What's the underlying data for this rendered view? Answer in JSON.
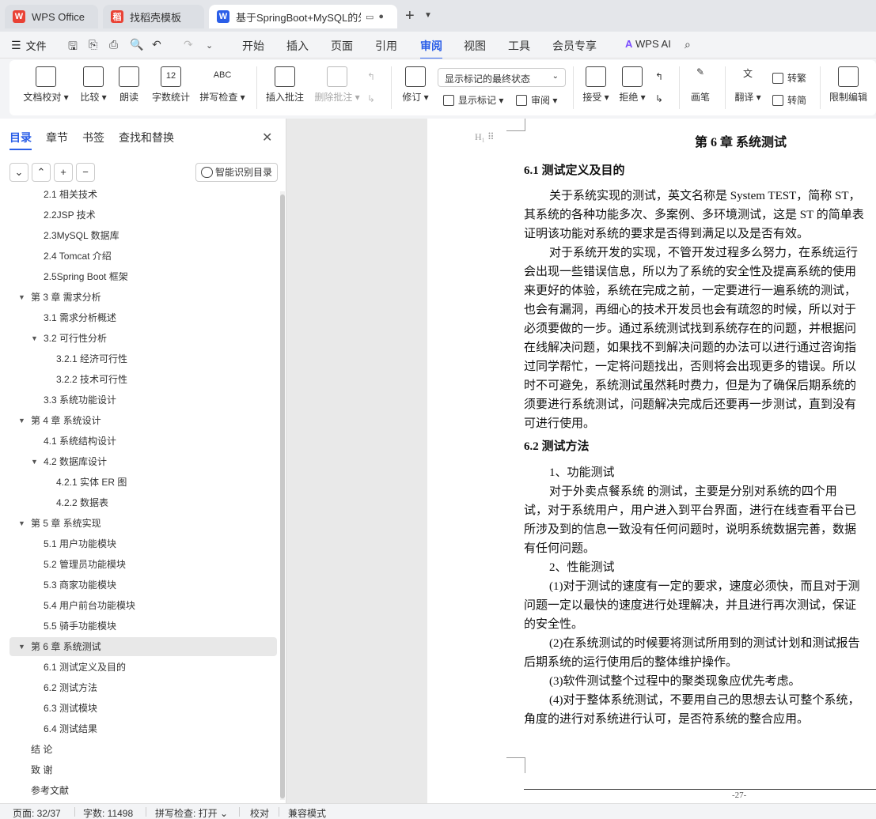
{
  "tabs": [
    {
      "label": "WPS Office",
      "icon": "wps-logo-icon"
    },
    {
      "label": "找稻壳模板",
      "icon": "docer-icon"
    },
    {
      "label": "基于SpringBoot+MySQL的外",
      "icon": "word-doc-icon"
    }
  ],
  "menu": {
    "file": "文件",
    "items": [
      "开始",
      "插入",
      "页面",
      "引用",
      "审阅",
      "视图",
      "工具",
      "会员专享"
    ],
    "active": "审阅",
    "wps_ai": "WPS AI"
  },
  "ribbon": {
    "doc_proof": "文档校对",
    "compare": "比较",
    "read_aloud": "朗读",
    "word_count": "字数统计",
    "spell_check": "拼写检查",
    "insert_comment": "插入批注",
    "delete_comment": "删除批注",
    "revise": "修订",
    "display_state": "显示标记的最终状态",
    "show_markup": "显示标记",
    "review": "审阅",
    "accept": "接受",
    "reject": "拒绝",
    "pen": "画笔",
    "translate": "翻译",
    "to_traditional": "转繁",
    "to_simplified": "转简",
    "restrict_edit": "限制编辑",
    "abc_label": "ABC",
    "count_label": "12"
  },
  "nav": {
    "tabs": [
      "目录",
      "章节",
      "书签",
      "查找和替换"
    ],
    "smart_toc": "智能识别目录",
    "toc": [
      {
        "label": "2.1 相关技术",
        "level": 2
      },
      {
        "label": "2.2JSP 技术",
        "level": 2
      },
      {
        "label": "2.3MySQL 数据库",
        "level": 2
      },
      {
        "label": "2.4 Tomcat 介绍",
        "level": 2
      },
      {
        "label": "2.5Spring Boot 框架",
        "level": 2
      },
      {
        "label": "第 3 章  需求分析",
        "level": 1,
        "expanded": true
      },
      {
        "label": "3.1 需求分析概述",
        "level": 2
      },
      {
        "label": "3.2 可行性分析",
        "level": 2,
        "expanded": true
      },
      {
        "label": "3.2.1 经济可行性",
        "level": 3
      },
      {
        "label": "3.2.2 技术可行性",
        "level": 3
      },
      {
        "label": "3.3 系统功能设计",
        "level": 2
      },
      {
        "label": "第 4 章  系统设计",
        "level": 1,
        "expanded": true
      },
      {
        "label": "4.1 系统结构设计",
        "level": 2
      },
      {
        "label": "4.2 数据库设计",
        "level": 2,
        "expanded": true
      },
      {
        "label": "4.2.1 实体 ER 图",
        "level": 3
      },
      {
        "label": "4.2.2 数据表",
        "level": 3
      },
      {
        "label": "第 5 章  系统实现",
        "level": 1,
        "expanded": true
      },
      {
        "label": "5.1 用户功能模块",
        "level": 2
      },
      {
        "label": "5.2 管理员功能模块",
        "level": 2
      },
      {
        "label": "5.3 商家功能模块",
        "level": 2
      },
      {
        "label": "5.4 用户前台功能模块",
        "level": 2
      },
      {
        "label": "5.5 骑手功能模块",
        "level": 2
      },
      {
        "label": "第 6 章  系统测试",
        "level": 1,
        "expanded": true,
        "selected": true
      },
      {
        "label": "6.1 测试定义及目的",
        "level": 2
      },
      {
        "label": "6.2 测试方法",
        "level": 2
      },
      {
        "label": "6.3 测试模块",
        "level": 2
      },
      {
        "label": "6.4 测试结果",
        "level": 2
      },
      {
        "label": "结    论",
        "level": 1
      },
      {
        "label": "致    谢",
        "level": 1
      },
      {
        "label": "参考文献",
        "level": 1
      }
    ]
  },
  "document": {
    "chapter_title": "第 6 章  系统测试",
    "heading_mark": "H",
    "sec1": "6.1 测试定义及目的",
    "p1": [
      "关于系统实现的测试，英文名称是 System TEST，简称 ST，",
      "其系统的各种功能多次、多案例、多环境测试，这是 ST 的简单表",
      "证明该功能对系统的要求是否得到满足以及是否有效。"
    ],
    "p2": [
      "对于系统开发的实现，不管开发过程多么努力，在系统运行",
      "会出现一些错误信息，所以为了系统的安全性及提高系统的使用",
      "来更好的体验，系统在完成之前，一定要进行一遍系统的测试，",
      "也会有漏洞，再细心的技术开发员也会有疏忽的时候，所以对于",
      "必须要做的一步。通过系统测试找到系统存在的问题，并根据问",
      "在线解决问题，如果找不到解决问题的办法可以进行通过咨询指",
      "过同学帮忙，一定将问题找出，否则将会出现更多的错误。所以",
      "时不可避免，系统测试虽然耗时费力，但是为了确保后期系统的",
      "须要进行系统测试，问题解决完成后还要再一步测试，直到没有",
      "可进行使用。"
    ],
    "sec2": "6.2 测试方法",
    "item1": "1、功能测试",
    "p3": [
      "对于外卖点餐系统       的测试，主要是分别对系统的四个用",
      "试，对于系统用户，用户进入到平台界面，进行在线查看平台已",
      "所涉及到的信息一致没有任何问题时，说明系统数据完善，数据",
      "有任何问题。"
    ],
    "item2": "2、性能测试",
    "p4": [
      "(1)对于测试的速度有一定的要求，速度必须快，而且对于测",
      "问题一定以最快的速度进行处理解决，并且进行再次测试，保证",
      "的安全性。"
    ],
    "p5": [
      "(2)在系统测试的时候要将测试所用到的测试计划和测试报告",
      "后期系统的运行使用后的整体维护操作。"
    ],
    "p6": "(3)软件测试整个过程中的聚类现象应优先考虑。",
    "p7": [
      "(4)对于整体系统测试，不要用自己的思想去认可整个系统，",
      "角度的进行对系统进行认可，是否符系统的整合应用。"
    ],
    "page_number": "-27-"
  },
  "status": {
    "page": "页面: 32/37",
    "words": "字数: 11498",
    "spell": "拼写检查: 打开",
    "proof": "校对",
    "compat": "兼容模式"
  },
  "colors": {
    "accent": "#2a5ee8",
    "wps_red": "#e94235"
  }
}
